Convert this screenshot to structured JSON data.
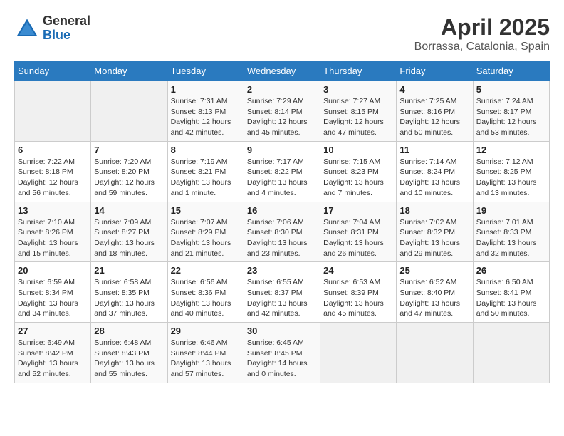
{
  "header": {
    "logo": {
      "general": "General",
      "blue": "Blue",
      "icon": "▶"
    },
    "title": "April 2025",
    "location": "Borrassa, Catalonia, Spain"
  },
  "weekdays": [
    "Sunday",
    "Monday",
    "Tuesday",
    "Wednesday",
    "Thursday",
    "Friday",
    "Saturday"
  ],
  "weeks": [
    [
      {
        "day": "",
        "info": ""
      },
      {
        "day": "",
        "info": ""
      },
      {
        "day": "1",
        "info": "Sunrise: 7:31 AM\nSunset: 8:13 PM\nDaylight: 12 hours and 42 minutes."
      },
      {
        "day": "2",
        "info": "Sunrise: 7:29 AM\nSunset: 8:14 PM\nDaylight: 12 hours and 45 minutes."
      },
      {
        "day": "3",
        "info": "Sunrise: 7:27 AM\nSunset: 8:15 PM\nDaylight: 12 hours and 47 minutes."
      },
      {
        "day": "4",
        "info": "Sunrise: 7:25 AM\nSunset: 8:16 PM\nDaylight: 12 hours and 50 minutes."
      },
      {
        "day": "5",
        "info": "Sunrise: 7:24 AM\nSunset: 8:17 PM\nDaylight: 12 hours and 53 minutes."
      }
    ],
    [
      {
        "day": "6",
        "info": "Sunrise: 7:22 AM\nSunset: 8:18 PM\nDaylight: 12 hours and 56 minutes."
      },
      {
        "day": "7",
        "info": "Sunrise: 7:20 AM\nSunset: 8:20 PM\nDaylight: 12 hours and 59 minutes."
      },
      {
        "day": "8",
        "info": "Sunrise: 7:19 AM\nSunset: 8:21 PM\nDaylight: 13 hours and 1 minute."
      },
      {
        "day": "9",
        "info": "Sunrise: 7:17 AM\nSunset: 8:22 PM\nDaylight: 13 hours and 4 minutes."
      },
      {
        "day": "10",
        "info": "Sunrise: 7:15 AM\nSunset: 8:23 PM\nDaylight: 13 hours and 7 minutes."
      },
      {
        "day": "11",
        "info": "Sunrise: 7:14 AM\nSunset: 8:24 PM\nDaylight: 13 hours and 10 minutes."
      },
      {
        "day": "12",
        "info": "Sunrise: 7:12 AM\nSunset: 8:25 PM\nDaylight: 13 hours and 13 minutes."
      }
    ],
    [
      {
        "day": "13",
        "info": "Sunrise: 7:10 AM\nSunset: 8:26 PM\nDaylight: 13 hours and 15 minutes."
      },
      {
        "day": "14",
        "info": "Sunrise: 7:09 AM\nSunset: 8:27 PM\nDaylight: 13 hours and 18 minutes."
      },
      {
        "day": "15",
        "info": "Sunrise: 7:07 AM\nSunset: 8:29 PM\nDaylight: 13 hours and 21 minutes."
      },
      {
        "day": "16",
        "info": "Sunrise: 7:06 AM\nSunset: 8:30 PM\nDaylight: 13 hours and 23 minutes."
      },
      {
        "day": "17",
        "info": "Sunrise: 7:04 AM\nSunset: 8:31 PM\nDaylight: 13 hours and 26 minutes."
      },
      {
        "day": "18",
        "info": "Sunrise: 7:02 AM\nSunset: 8:32 PM\nDaylight: 13 hours and 29 minutes."
      },
      {
        "day": "19",
        "info": "Sunrise: 7:01 AM\nSunset: 8:33 PM\nDaylight: 13 hours and 32 minutes."
      }
    ],
    [
      {
        "day": "20",
        "info": "Sunrise: 6:59 AM\nSunset: 8:34 PM\nDaylight: 13 hours and 34 minutes."
      },
      {
        "day": "21",
        "info": "Sunrise: 6:58 AM\nSunset: 8:35 PM\nDaylight: 13 hours and 37 minutes."
      },
      {
        "day": "22",
        "info": "Sunrise: 6:56 AM\nSunset: 8:36 PM\nDaylight: 13 hours and 40 minutes."
      },
      {
        "day": "23",
        "info": "Sunrise: 6:55 AM\nSunset: 8:37 PM\nDaylight: 13 hours and 42 minutes."
      },
      {
        "day": "24",
        "info": "Sunrise: 6:53 AM\nSunset: 8:39 PM\nDaylight: 13 hours and 45 minutes."
      },
      {
        "day": "25",
        "info": "Sunrise: 6:52 AM\nSunset: 8:40 PM\nDaylight: 13 hours and 47 minutes."
      },
      {
        "day": "26",
        "info": "Sunrise: 6:50 AM\nSunset: 8:41 PM\nDaylight: 13 hours and 50 minutes."
      }
    ],
    [
      {
        "day": "27",
        "info": "Sunrise: 6:49 AM\nSunset: 8:42 PM\nDaylight: 13 hours and 52 minutes."
      },
      {
        "day": "28",
        "info": "Sunrise: 6:48 AM\nSunset: 8:43 PM\nDaylight: 13 hours and 55 minutes."
      },
      {
        "day": "29",
        "info": "Sunrise: 6:46 AM\nSunset: 8:44 PM\nDaylight: 13 hours and 57 minutes."
      },
      {
        "day": "30",
        "info": "Sunrise: 6:45 AM\nSunset: 8:45 PM\nDaylight: 14 hours and 0 minutes."
      },
      {
        "day": "",
        "info": ""
      },
      {
        "day": "",
        "info": ""
      },
      {
        "day": "",
        "info": ""
      }
    ]
  ]
}
